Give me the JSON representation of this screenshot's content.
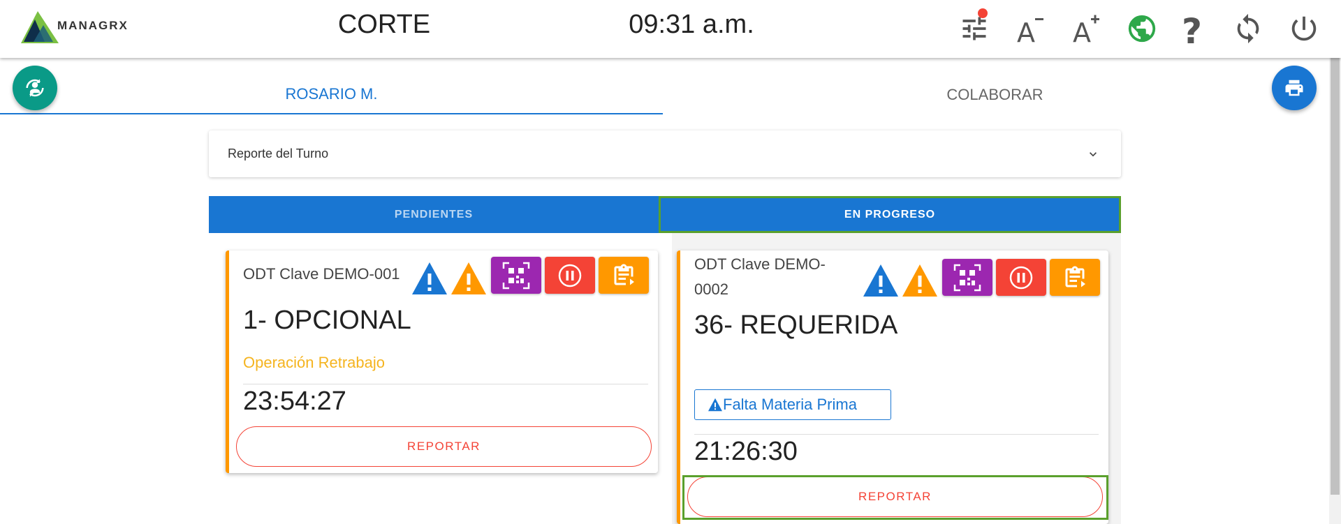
{
  "header": {
    "logo_text": "MANAGRX",
    "screen_title": "CORTE",
    "clock": "09:31 a.m.",
    "icons": [
      "filter-settings-icon",
      "font-decrease-icon",
      "font-increase-icon",
      "globe-icon",
      "help-icon",
      "refresh-icon",
      "power-icon"
    ]
  },
  "user_tabs": [
    {
      "label": "ROSARIO M.",
      "active": true
    },
    {
      "label": "COLABORAR",
      "active": false
    }
  ],
  "shift_report": {
    "label": "Reporte del Turno"
  },
  "state_tabs": [
    {
      "label": "PENDIENTES",
      "active": false
    },
    {
      "label": "EN PROGRESO",
      "active": true
    }
  ],
  "cards": [
    {
      "odt": "ODT Clave DEMO-001",
      "operation": "1- OPCIONAL",
      "subtitle": "Operación Retrabajo",
      "timer": "23:54:27",
      "report_label": "REPORTAR"
    },
    {
      "odt_line1": "ODT Clave DEMO-",
      "odt_line2": "0002",
      "operation": "36- REQUERIDA",
      "alert": "Falta Materia Prima",
      "timer": "21:26:30",
      "report_label": "REPORTAR"
    }
  ],
  "colors": {
    "primary": "#1976d2",
    "teal": "#0a9a87",
    "orange": "#ff9800",
    "red": "#f44336",
    "purple": "#9c27b0",
    "green_highlight": "#5aa02c"
  }
}
